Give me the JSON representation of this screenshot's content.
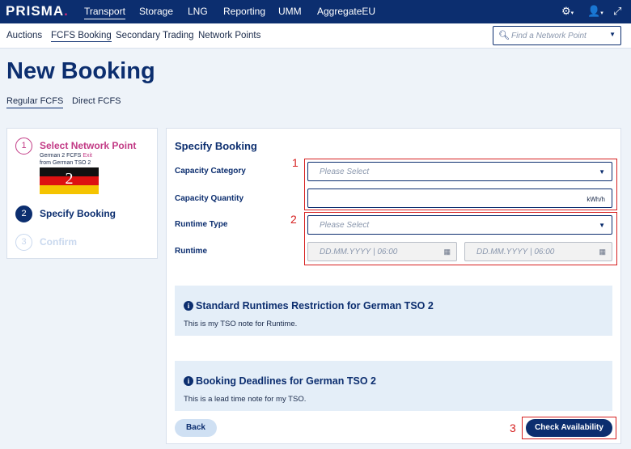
{
  "app": {
    "logo": "PRISMA",
    "logo_dot": "."
  },
  "topnav": {
    "items": [
      "Transport",
      "Storage",
      "LNG",
      "Reporting",
      "UMM",
      "AggregateEU"
    ]
  },
  "subnav": {
    "items": [
      "Auctions",
      "FCFS Booking",
      "Secondary Trading",
      "Network Points"
    ],
    "search_placeholder": "Find a Network Point"
  },
  "page": {
    "title": "New Booking",
    "tabs": [
      "Regular FCFS",
      "Direct FCFS"
    ]
  },
  "stepper": {
    "steps": [
      {
        "num": "1",
        "label": "Select Network Point"
      },
      {
        "num": "2",
        "label": "Specify Booking"
      },
      {
        "num": "3",
        "label": "Confirm"
      }
    ],
    "network_point": {
      "line1": "German 2 FCFS",
      "exit": "Exit",
      "line2": "from German TSO 2"
    },
    "flag_annotation": "2"
  },
  "form": {
    "section_title": "Specify Booking",
    "capacity_category": {
      "label": "Capacity Category",
      "placeholder": "Please Select"
    },
    "capacity_quantity": {
      "label": "Capacity Quantity",
      "unit": "kWh/h"
    },
    "runtime_type": {
      "label": "Runtime Type",
      "placeholder": "Please Select"
    },
    "runtime": {
      "label": "Runtime",
      "from_placeholder": "DD.MM.YYYY | 06:00",
      "to_placeholder": "DD.MM.YYYY | 06:00"
    }
  },
  "annotations": [
    "1",
    "2",
    "3"
  ],
  "info_boxes": [
    {
      "title": "Standard Runtimes Restriction for German TSO 2",
      "text": "This is my TSO note for Runtime."
    },
    {
      "title": "Booking Deadlines for German TSO 2",
      "text": "This is a lead time note for my TSO."
    }
  ],
  "buttons": {
    "back": "Back",
    "check": "Check Availability"
  },
  "colors": {
    "primary": "#0c2e6f",
    "accent": "#c23a85",
    "annotation": "#d62020",
    "info_bg": "#e4eef8"
  }
}
